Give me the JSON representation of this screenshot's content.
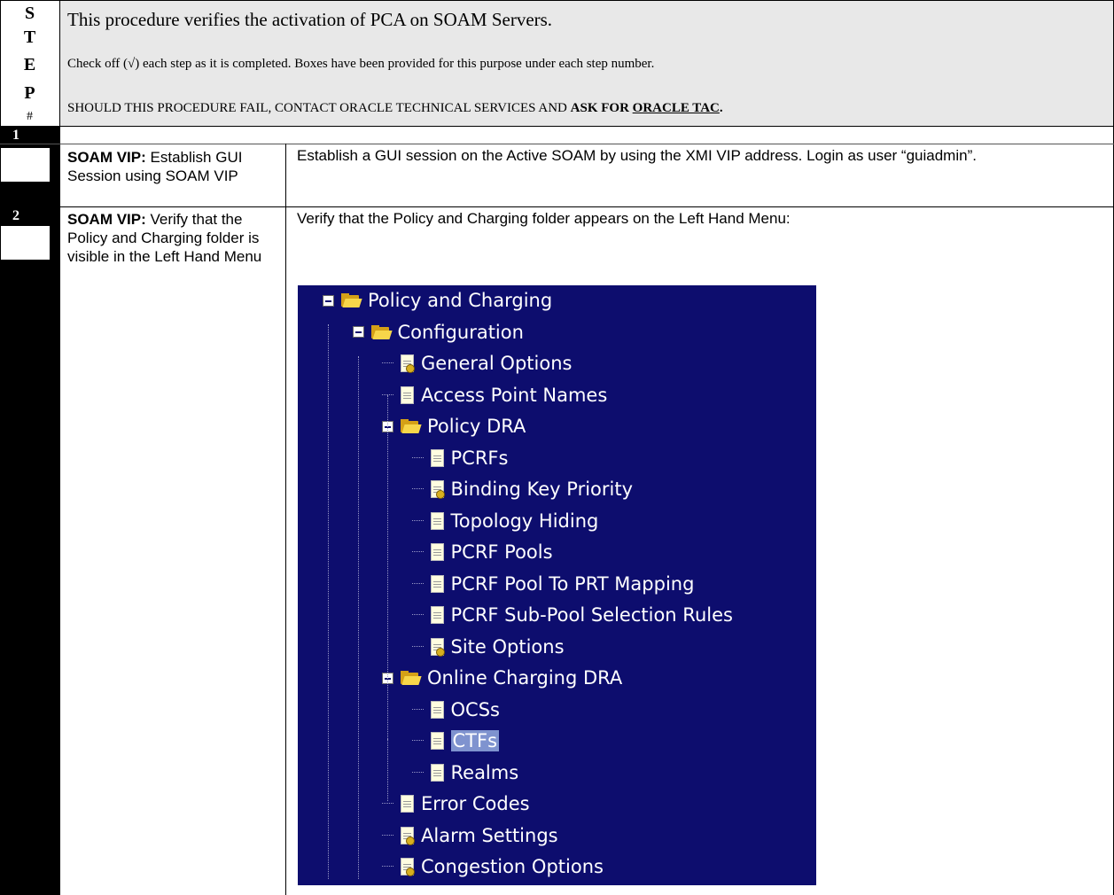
{
  "header": {
    "step_letters": [
      "S",
      "T",
      "E",
      "P",
      "#"
    ],
    "intro": "This procedure verifies the activation of PCA on SOAM Servers.",
    "checkoff": "Check off (√) each step as it is completed. Boxes have been provided for this purpose under each step number.",
    "warning_prefix": "SHOULD THIS PROCEDURE FAIL, CONTACT ORACLE TECHNICAL SERVICES AND ",
    "warning_ask": "ASK FOR ",
    "warning_tac": "ORACLE TAC",
    "warning_end": "."
  },
  "steps": [
    {
      "number": "1",
      "desc_bold": "SOAM VIP:",
      "desc_rest": " Establish GUI Session using SOAM VIP",
      "body": "Establish a GUI session on the Active SOAM by using the XMI VIP address. Login as user “guiadmin”."
    },
    {
      "number": "2",
      "desc_bold": "SOAM VIP:",
      "desc_rest": " Verify that the Policy and Charging folder is visible in the Left Hand Menu",
      "body": "Verify that the Policy and Charging folder appears on the Left Hand Menu:"
    }
  ],
  "tree": {
    "items": [
      {
        "label": "Policy and Charging",
        "icon": "folder-icon",
        "level": 0
      },
      {
        "label": "Configuration",
        "icon": "folder-icon",
        "level": 1
      },
      {
        "label": "General Options",
        "icon": "options-doc-icon",
        "level": 2
      },
      {
        "label": "Access Point Names",
        "icon": "document-icon",
        "level": 2
      },
      {
        "label": "Policy DRA",
        "icon": "folder-icon",
        "level": 2
      },
      {
        "label": "PCRFs",
        "icon": "document-icon",
        "level": 3
      },
      {
        "label": "Binding Key Priority",
        "icon": "options-doc-icon",
        "level": 3
      },
      {
        "label": "Topology Hiding",
        "icon": "document-icon",
        "level": 3
      },
      {
        "label": "PCRF Pools",
        "icon": "document-icon",
        "level": 3
      },
      {
        "label": "PCRF Pool To PRT Mapping",
        "icon": "document-icon",
        "level": 3
      },
      {
        "label": "PCRF Sub-Pool Selection Rules",
        "icon": "document-icon",
        "level": 3
      },
      {
        "label": "Site Options",
        "icon": "options-doc-icon",
        "level": 3
      },
      {
        "label": "Online Charging DRA",
        "icon": "folder-icon",
        "level": 2
      },
      {
        "label": "OCSs",
        "icon": "document-icon",
        "level": 3
      },
      {
        "label": "CTFs",
        "icon": "document-icon",
        "level": 3,
        "selected": true
      },
      {
        "label": "Realms",
        "icon": "document-icon",
        "level": 3
      },
      {
        "label": "Error Codes",
        "icon": "document-icon",
        "level": 2
      },
      {
        "label": "Alarm Settings",
        "icon": "options-doc-icon",
        "level": 2
      },
      {
        "label": "Congestion Options",
        "icon": "options-doc-icon",
        "level": 2
      }
    ]
  },
  "colors": {
    "tree_bg": "#0d0d6e",
    "header_bg": "#e8e8e8",
    "step_column": "#000000"
  }
}
